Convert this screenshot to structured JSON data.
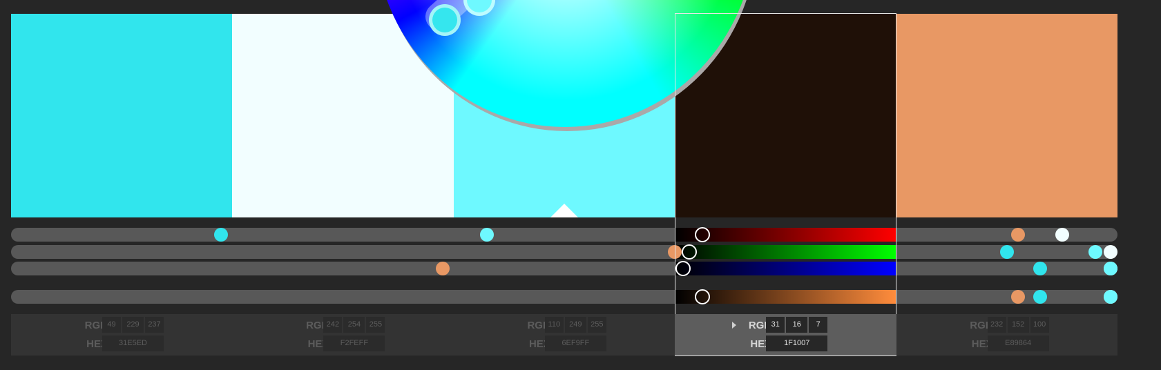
{
  "palette": {
    "swatches": [
      {
        "hex": "31E5ED",
        "color": "#31E5ED",
        "rgb": [
          "49",
          "229",
          "237"
        ]
      },
      {
        "hex": "F2FEFF",
        "color": "#F2FEFF",
        "rgb": [
          "242",
          "254",
          "255"
        ]
      },
      {
        "hex": "6EF9FF",
        "color": "#6EF9FF",
        "rgb": [
          "110",
          "249",
          "255"
        ]
      },
      {
        "hex": "1F1007",
        "color": "#1F1007",
        "rgb": [
          "31",
          "16",
          "7"
        ]
      },
      {
        "hex": "E89864",
        "color": "#E89864",
        "rgb": [
          "232",
          "152",
          "100"
        ]
      }
    ],
    "selected_index": 3
  },
  "labels": {
    "rgb": "RGB",
    "hex": "HEX"
  },
  "color_wheel": {
    "visible": true
  },
  "sliders": {
    "channels": [
      "red",
      "green",
      "blue",
      "brightness"
    ],
    "values": [
      [
        0.19,
        0.9,
        0.93,
        0.93
      ],
      [
        0.95,
        1.0,
        1.0,
        1.0
      ],
      [
        0.43,
        0.98,
        1.0,
        1.0
      ],
      [
        0.12,
        0.06,
        0.03,
        0.12
      ],
      [
        0.91,
        0.6,
        0.39,
        0.91
      ]
    ]
  }
}
